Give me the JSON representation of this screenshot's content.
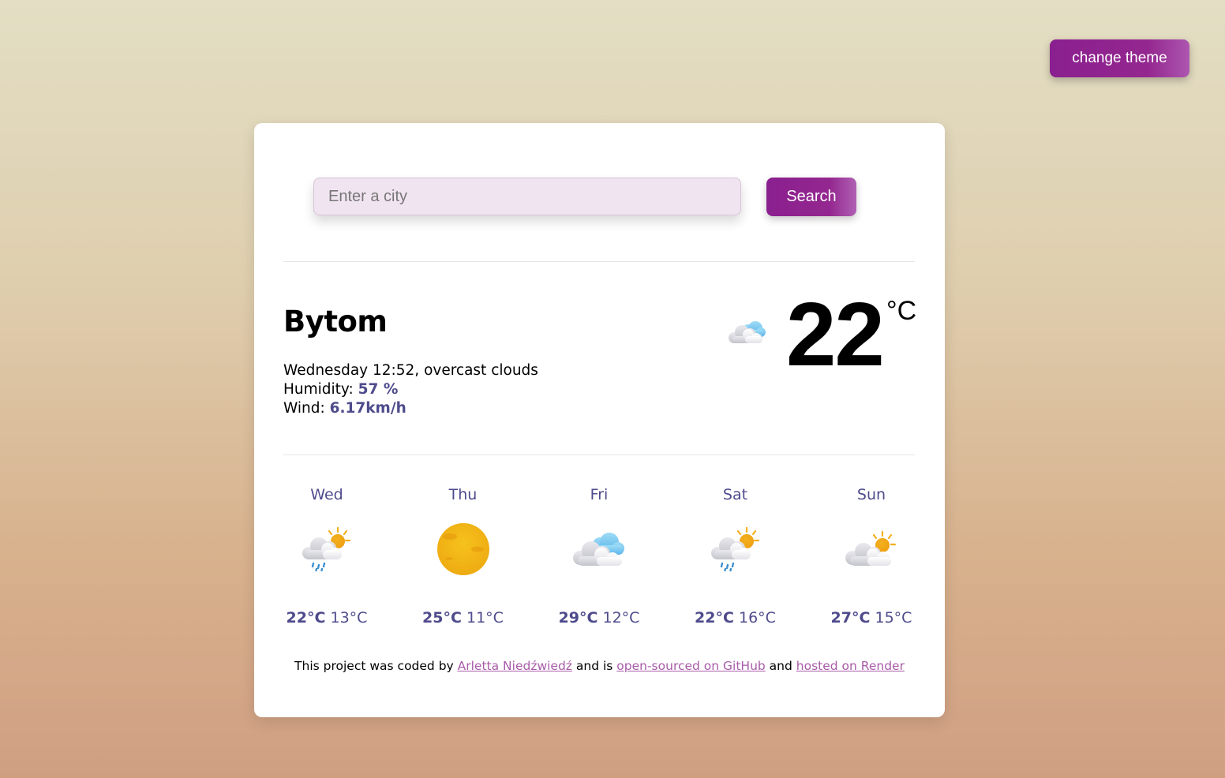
{
  "theme_button": {
    "label": "change theme"
  },
  "search": {
    "placeholder": "Enter a city",
    "value": "",
    "button_label": "Search"
  },
  "current": {
    "city": "Bytom",
    "description": "Wednesday 12:52, overcast clouds",
    "humidity_label": "Humidity: ",
    "humidity_value": "57 %",
    "wind_label": "Wind: ",
    "wind_value": "6.17km/h",
    "temperature": "22",
    "unit": "°C",
    "icon": "overcast-clouds-icon"
  },
  "forecast": [
    {
      "day": "Wed",
      "max": "22°C",
      "min": "13°C",
      "icon": "rain-sun-icon"
    },
    {
      "day": "Thu",
      "max": "25°C",
      "min": "11°C",
      "icon": "sun-icon"
    },
    {
      "day": "Fri",
      "max": "29°C",
      "min": "12°C",
      "icon": "clouds-icon"
    },
    {
      "day": "Sat",
      "max": "22°C",
      "min": "16°C",
      "icon": "rain-sun-icon"
    },
    {
      "day": "Sun",
      "max": "27°C",
      "min": "15°C",
      "icon": "partly-cloudy-icon"
    }
  ],
  "footer": {
    "text1": "This project was coded by ",
    "author_link": "Arletta Niedźwiedź",
    "text2": " and is ",
    "github_link": "open-sourced on GitHub",
    "text3": " and ",
    "render_link": "hosted on Render"
  },
  "colors": {
    "accent": "#94278f",
    "highlight": "#4e4b8c",
    "link": "#a85ca8"
  }
}
